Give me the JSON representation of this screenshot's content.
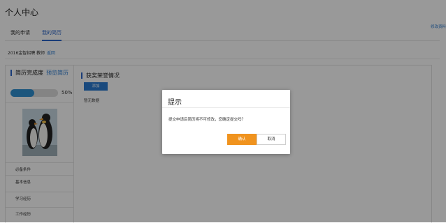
{
  "page": {
    "title": "个人中心",
    "right_link": "修改资料"
  },
  "tabs": [
    {
      "label": "我的申请",
      "active": false
    },
    {
      "label": "我的简历",
      "active": true
    }
  ],
  "subline": {
    "text": "2016金智招聘 教师",
    "action": "返回"
  },
  "sidebar": {
    "title": "简历完成度",
    "preview_link": "预览简历",
    "progress_percent": 50,
    "progress_label": "50%",
    "items": [
      {
        "label": "必备条件"
      },
      {
        "label": "基本信息"
      },
      {
        "label": "学习经历"
      },
      {
        "label": "工作经历"
      }
    ]
  },
  "main": {
    "section_title": "获奖荣誉情况",
    "add_button": "添加",
    "empty_text": "暂无数据"
  },
  "dialog": {
    "title": "提示",
    "message": "提交申请后简历将不可修改，您确定提交吗？",
    "ok_label": "确认",
    "cancel_label": "取消"
  },
  "colors": {
    "accent": "#2a64c8",
    "link": "#2a7bd1",
    "progress": "#2f8fd1",
    "confirm": "#f0931e"
  }
}
